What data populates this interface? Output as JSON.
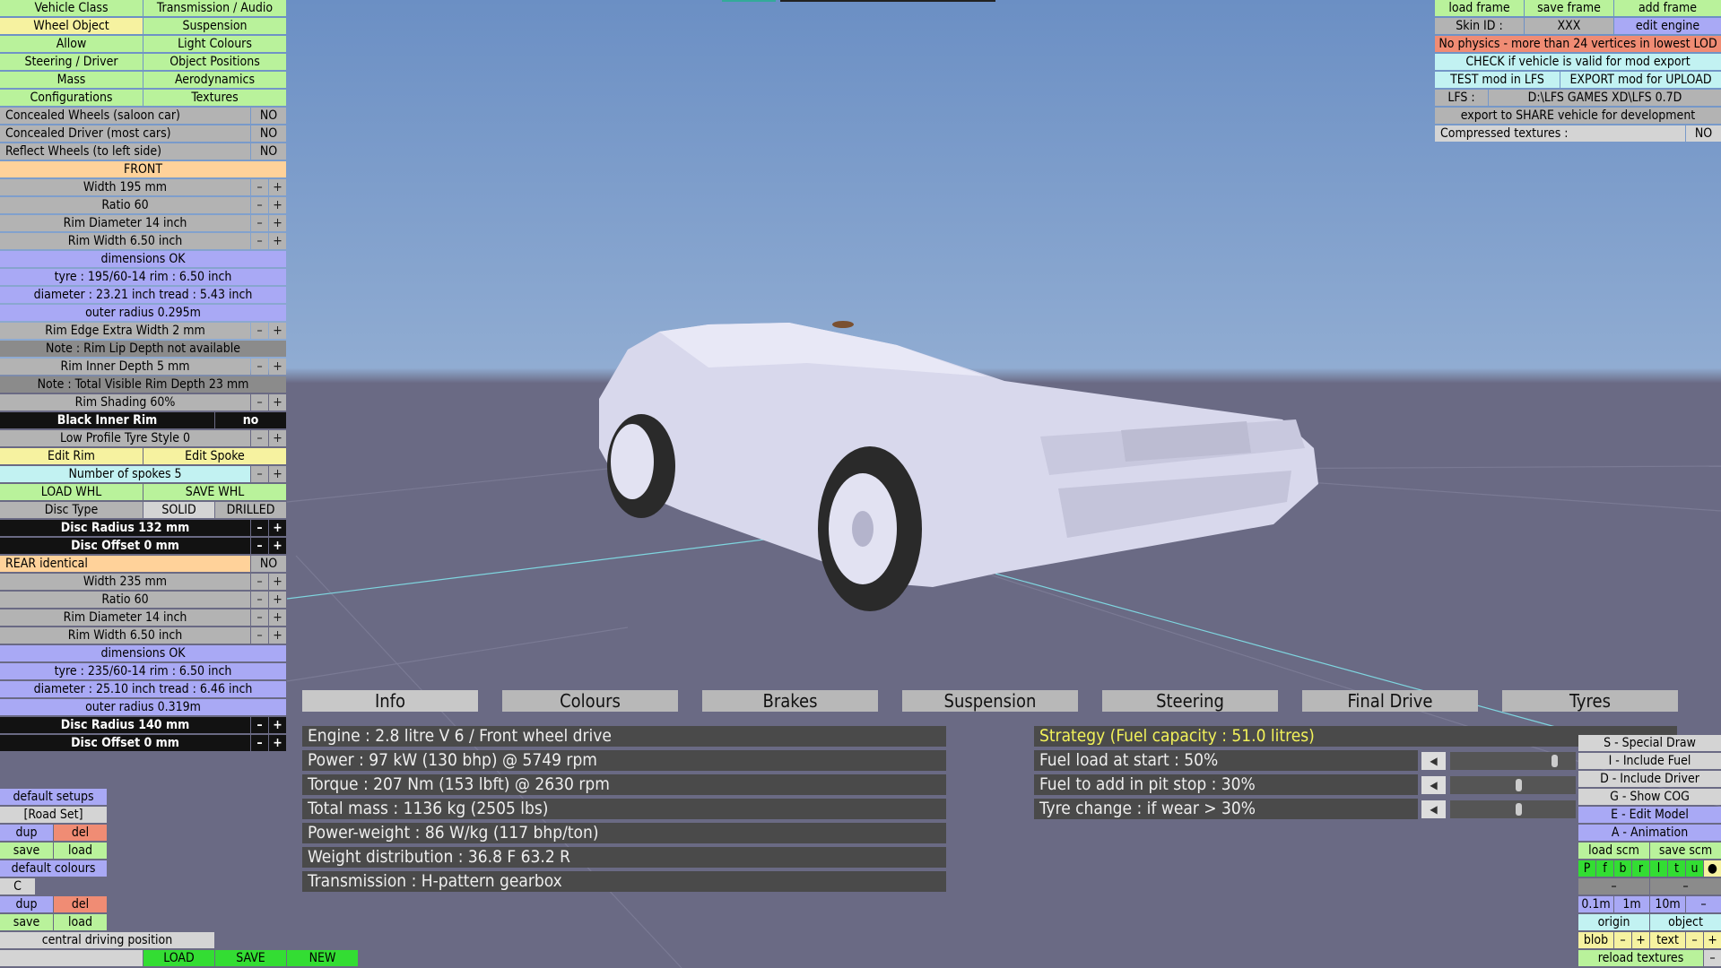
{
  "menu": {
    "vehicle_class": "Vehicle Class",
    "transmission_audio": "Transmission / Audio",
    "wheel_object": "Wheel Object",
    "suspension": "Suspension",
    "allow": "Allow",
    "light_colours": "Light Colours",
    "steering_driver": "Steering / Driver",
    "object_positions": "Object Positions",
    "mass": "Mass",
    "aerodynamics": "Aerodynamics",
    "configurations": "Configurations",
    "textures": "Textures"
  },
  "options": {
    "concealed_wheels": "Concealed Wheels (saloon car)",
    "concealed_wheels_val": "NO",
    "concealed_driver": "Concealed Driver (most cars)",
    "concealed_driver_val": "NO",
    "reflect_wheels": "Reflect Wheels (to left side)",
    "reflect_wheels_val": "NO"
  },
  "front": {
    "header": "FRONT",
    "width": "Width 195 mm",
    "ratio": "Ratio 60",
    "rim_diameter": "Rim Diameter 14 inch",
    "rim_width": "Rim Width 6.50 inch",
    "dimensions": "dimensions OK",
    "tyre": "tyre : 195/60-14    rim : 6.50 inch",
    "diameter": "diameter : 23.21 inch    tread : 5.43 inch",
    "outer_radius": "outer radius 0.295m",
    "rim_edge": "Rim Edge Extra Width 2 mm",
    "note_lip": "Note : Rim Lip Depth not available",
    "rim_inner": "Rim Inner Depth 5 mm",
    "note_depth": "Note : Total Visible Rim Depth 23 mm",
    "rim_shading": "Rim Shading 60%",
    "black_inner": "Black Inner Rim",
    "black_inner_val": "no",
    "low_profile": "Low Profile Tyre Style 0",
    "edit_rim": "Edit Rim",
    "edit_spoke": "Edit Spoke",
    "spokes": "Number of spokes 5",
    "load_whl": "LOAD WHL",
    "save_whl": "SAVE WHL",
    "disc_type": "Disc Type",
    "solid": "SOLID",
    "drilled": "DRILLED",
    "disc_radius": "Disc Radius 132 mm",
    "disc_offset": "Disc Offset 0 mm"
  },
  "rear": {
    "identical": "REAR identical",
    "identical_val": "NO",
    "width": "Width 235 mm",
    "ratio": "Ratio 60",
    "rim_diameter": "Rim Diameter 14 inch",
    "rim_width": "Rim Width 6.50 inch",
    "dimensions": "dimensions OK",
    "tyre": "tyre : 235/60-14    rim : 6.50 inch",
    "diameter": "diameter : 25.10 inch    tread : 6.46 inch",
    "outer_radius": "outer radius 0.319m",
    "disc_radius": "Disc Radius 140 mm",
    "disc_offset": "Disc Offset 0 mm"
  },
  "pm": {
    "minus": "–",
    "plus": "+"
  },
  "setups": {
    "default_setups": "default setups",
    "road_set": "[Road Set]",
    "dup": "dup",
    "del": "del",
    "save": "save",
    "load": "load",
    "default_colours": "default colours",
    "c": "C",
    "central": "central driving position",
    "LOAD": "LOAD",
    "SAVE": "SAVE",
    "NEW": "NEW"
  },
  "topright": {
    "load_frame": "load frame",
    "save_frame": "save frame",
    "add_frame": "add frame",
    "skin_id": "Skin ID :",
    "skin_val": "XXX",
    "edit_engine": "edit engine",
    "warning": "No physics - more than 24 vertices in lowest LOD",
    "check": "CHECK if vehicle is valid for mod export",
    "test": "TEST mod in LFS",
    "export": "EXPORT mod for UPLOAD",
    "lfs": "LFS :",
    "lfs_path": "D:\\LFS GAMES XD\\LFS 0.7D",
    "share": "export to SHARE vehicle for development",
    "compressed": "Compressed textures :",
    "compressed_val": "NO"
  },
  "tabs": [
    "Info",
    "Colours",
    "Brakes",
    "Suspension",
    "Steering",
    "Final Drive",
    "Tyres"
  ],
  "info": [
    "Engine : 2.8 litre V 6 / Front wheel drive",
    "Power : 97 kW (130 bhp) @ 5749 rpm",
    "Torque : 207 Nm (153 lbft) @ 2630 rpm",
    "Total mass : 1136 kg (2505 lbs)",
    "Power-weight : 86 W/kg (117 bhp/ton)",
    "Weight distribution : 36.8 F  63.2 R",
    "Transmission : H-pattern gearbox"
  ],
  "strategy": {
    "title": "Strategy (Fuel capacity : 51.0 litres)",
    "fuel_start": "Fuel load at start : 50%",
    "fuel_start_level": 0.85,
    "fuel_pit": "Fuel to add in pit stop : 30%",
    "fuel_pit_level": 0.55,
    "tyre_change": "Tyre change : if wear > 30%",
    "tyre_change_level": 0.55,
    "arrow": "◀"
  },
  "rightpanel": {
    "special_draw": "S - Special Draw",
    "include_fuel": "I - Include Fuel",
    "include_driver": "D - Include Driver",
    "show_cog": "G - Show COG",
    "edit_model": "E - Edit Model",
    "animation": "A - Animation",
    "load_scm": "load scm",
    "save_scm": "save scm",
    "letters": [
      "P",
      "f",
      "b",
      "r",
      "l",
      "t",
      "u",
      "●"
    ],
    "dash": "–",
    "m01": "0.1m",
    "m1": "1m",
    "m10": "10m",
    "origin": "origin",
    "object": "object",
    "blob": "blob",
    "text": "text",
    "reload": "reload textures"
  },
  "colors": {
    "green": "#b9f29b",
    "blue": "#a9a9f5",
    "orange": "#ffd29a",
    "sky": "#6b8fc4",
    "ground": "#6a6a84",
    "warning": "#f08c74",
    "strategy": "#f2f25a"
  }
}
